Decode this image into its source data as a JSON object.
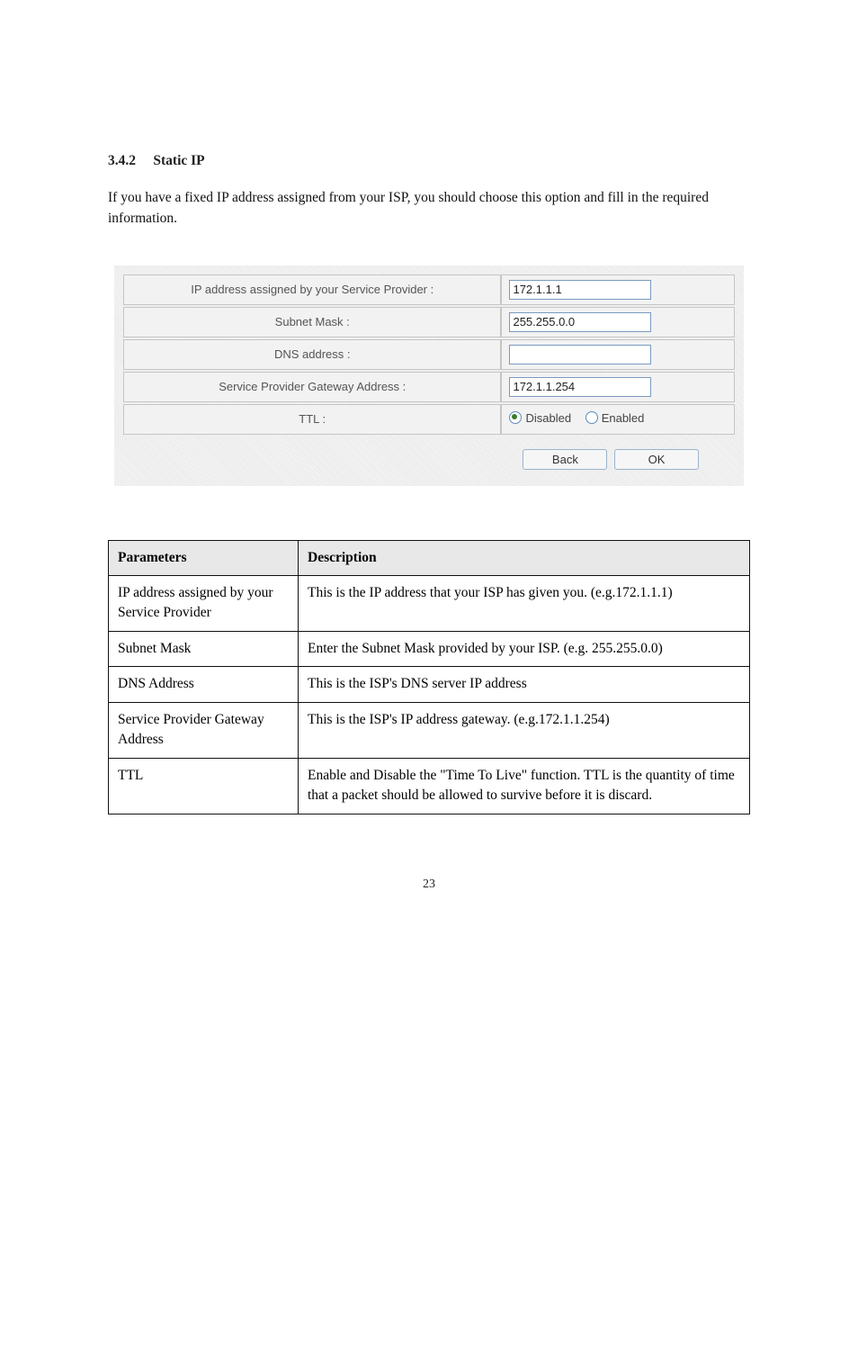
{
  "heading": {
    "number": "3.4.2",
    "title": "Static IP"
  },
  "intro": "If you have a fixed IP address assigned from your ISP, you should choose this option and fill in the required information.",
  "form": {
    "rows": {
      "ip": {
        "label": "IP address assigned by your Service Provider :",
        "value": "172.1.1.1"
      },
      "subnet": {
        "label": "Subnet Mask :",
        "value": "255.255.0.0"
      },
      "dns": {
        "label": "DNS address :",
        "value": ""
      },
      "gateway": {
        "label": "Service Provider Gateway Address :",
        "value": "172.1.1.254"
      },
      "ttl": {
        "label": "TTL :",
        "option_disabled": "Disabled",
        "option_enabled": "Enabled",
        "selected": "disabled"
      }
    },
    "buttons": {
      "back": "Back",
      "ok": "OK"
    }
  },
  "desc": {
    "header": {
      "param": "Parameters",
      "description": "Description"
    },
    "rows": [
      {
        "param": "IP address assigned by your Service Provider",
        "description": "This is the IP address that your ISP has given you. (e.g.172.1.1.1)"
      },
      {
        "param": "Subnet Mask",
        "description": "Enter the Subnet Mask provided by your ISP. (e.g. 255.255.0.0)"
      },
      {
        "param": "DNS Address",
        "description": "This is the ISP's DNS server IP address"
      },
      {
        "param": "Service Provider Gateway Address",
        "description": "This is the ISP's IP address gateway. (e.g.172.1.1.254)"
      },
      {
        "param": "TTL",
        "description": "Enable and Disable the \"Time To Live\" function. TTL is the quantity of time that a packet should be allowed to survive before it is discard."
      }
    ]
  },
  "page_number": "23"
}
